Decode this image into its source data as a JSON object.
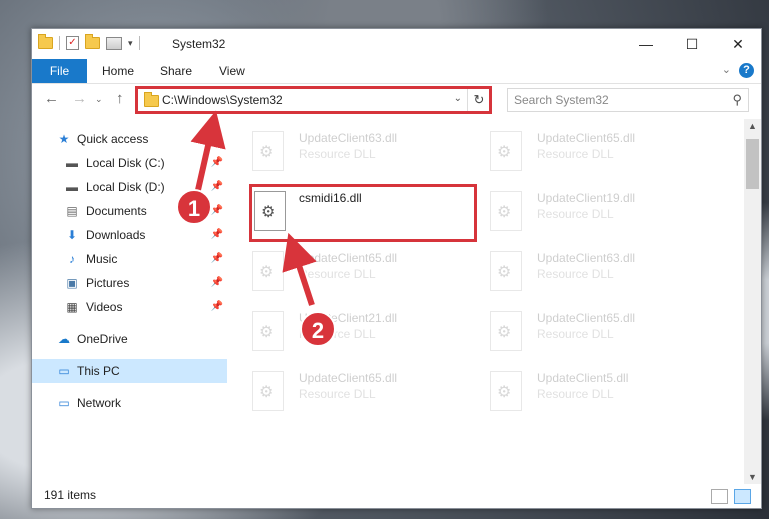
{
  "window": {
    "title": "System32"
  },
  "titlebar": {
    "minimize": "—",
    "maximize": "☐",
    "close": "✕"
  },
  "ribbon": {
    "file": "File",
    "tabs": [
      "Home",
      "Share",
      "View"
    ],
    "help": "?"
  },
  "address": {
    "path": "C:\\Windows\\System32"
  },
  "search": {
    "placeholder": "Search System32"
  },
  "sidebar": {
    "items": [
      {
        "label": "Quick access",
        "icon": "star-icon",
        "pinned": false
      },
      {
        "label": "Local Disk (C:)",
        "icon": "drive-icon",
        "pinned": true
      },
      {
        "label": "Local Disk (D:)",
        "icon": "drive-icon",
        "pinned": true
      },
      {
        "label": "Documents",
        "icon": "documents-icon",
        "pinned": true
      },
      {
        "label": "Downloads",
        "icon": "download-icon",
        "pinned": true
      },
      {
        "label": "Music",
        "icon": "music-icon",
        "pinned": true
      },
      {
        "label": "Pictures",
        "icon": "pictures-icon",
        "pinned": true
      },
      {
        "label": "Videos",
        "icon": "videos-icon",
        "pinned": true
      },
      {
        "label": "OneDrive",
        "icon": "cloud-icon",
        "pinned": false
      },
      {
        "label": "This PC",
        "icon": "computer-icon",
        "pinned": false,
        "selected": true
      },
      {
        "label": "Network",
        "icon": "network-icon",
        "pinned": false
      }
    ]
  },
  "files": [
    {
      "name": "UpdateClient63.dll",
      "type": "Resource DLL"
    },
    {
      "name": "UpdateClient65.dll",
      "type": "Resource DLL"
    },
    {
      "name": "csmidi16.dll",
      "type": ""
    },
    {
      "name": "UpdateClient19.dll",
      "type": "Resource DLL"
    },
    {
      "name": "UpdateClient65.dll",
      "type": "Resource DLL"
    },
    {
      "name": "UpdateClient63.dll",
      "type": "Resource DLL"
    },
    {
      "name": "UpdateClient21.dll",
      "type": "Resource DLL"
    },
    {
      "name": "UpdateClient65.dll",
      "type": "Resource DLL"
    },
    {
      "name": "UpdateClient65.dll",
      "type": "Resource DLL"
    },
    {
      "name": "UpdateClient5.dll",
      "type": "Resource DLL"
    }
  ],
  "status": {
    "count": "191 items"
  },
  "annotations": {
    "marker1": "1",
    "marker2": "2",
    "color": "#d6343b"
  }
}
